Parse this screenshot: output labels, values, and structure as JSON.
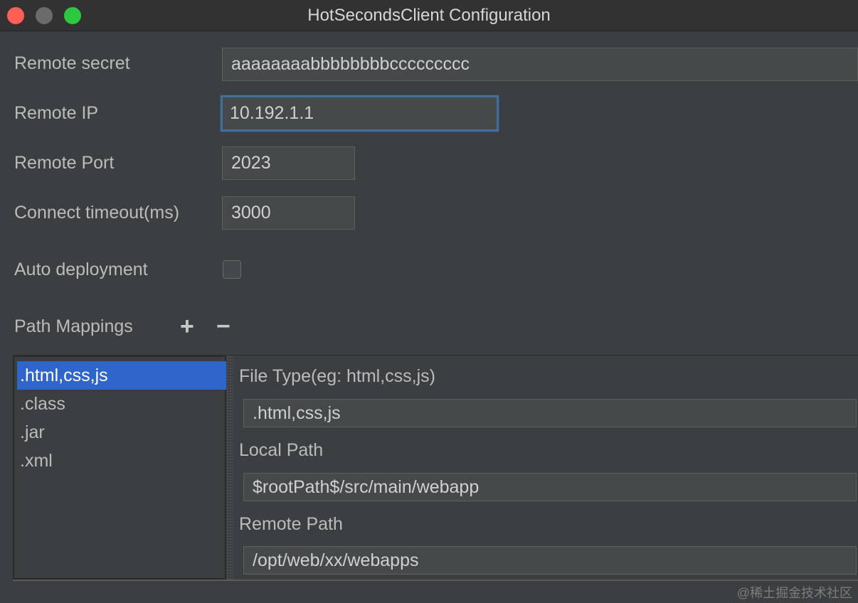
{
  "window": {
    "title": "HotSecondsClient Configuration"
  },
  "form": {
    "remote_secret": {
      "label": "Remote secret",
      "value": "aaaaaaaabbbbbbbbccccccccc"
    },
    "remote_ip": {
      "label": "Remote IP",
      "value": "10.192.1.1"
    },
    "remote_port": {
      "label": "Remote Port",
      "value": "2023"
    },
    "connect_timeout": {
      "label": "Connect timeout(ms)",
      "value": "3000"
    },
    "auto_deployment": {
      "label": "Auto deployment",
      "checked": false
    }
  },
  "path_mappings": {
    "label": "Path Mappings",
    "add_label": "+",
    "remove_label": "−",
    "items": [
      ".html,css,js",
      ".class",
      ".jar",
      ".xml"
    ],
    "selected_index": 0,
    "detail": {
      "file_type_label": "File Type(eg: html,css,js)",
      "file_type_value": ".html,css,js",
      "local_path_label": "Local Path",
      "local_path_value": "$rootPath$/src/main/webapp",
      "remote_path_label": "Remote Path",
      "remote_path_value": "/opt/web/xx/webapps"
    }
  },
  "watermark": "@稀土掘金技术社区",
  "colors": {
    "background": "#3c3f41",
    "selection": "#2f65ca",
    "focus_border": "#466d94",
    "close": "#ff5f57",
    "maximize": "#2bc840"
  }
}
